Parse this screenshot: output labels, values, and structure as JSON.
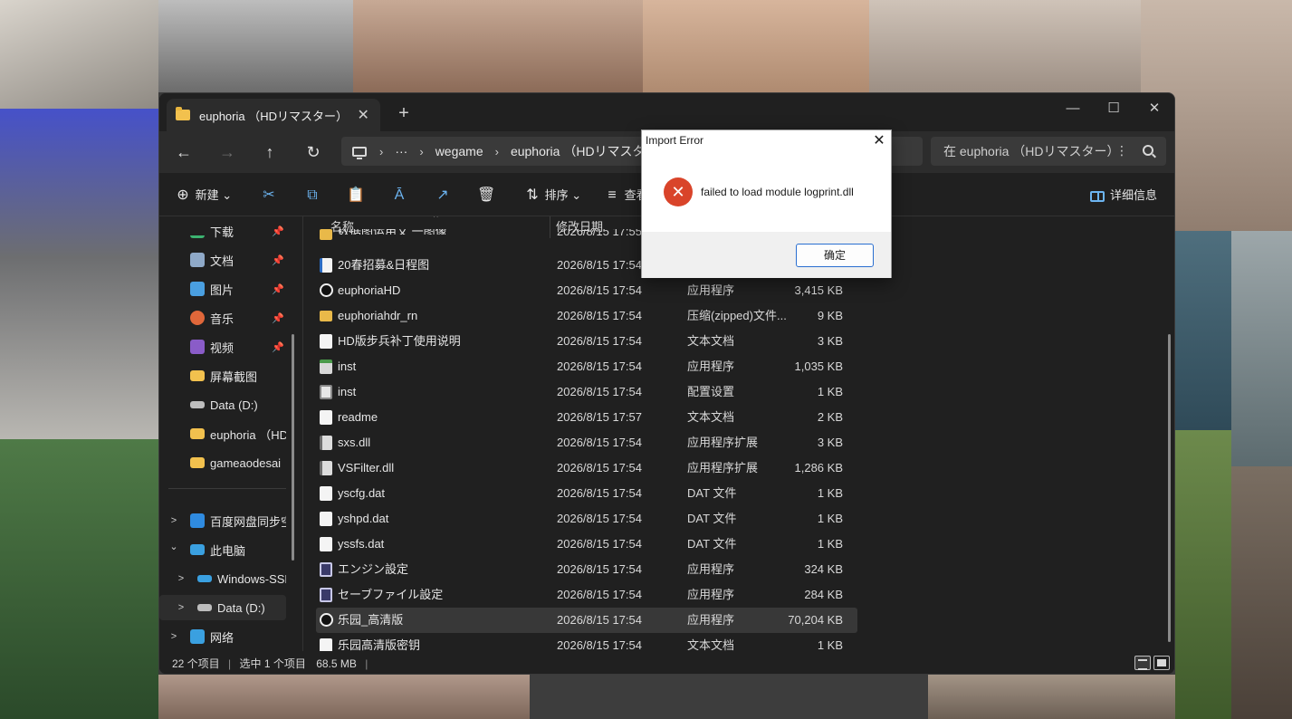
{
  "window": {
    "tab_title": "euphoria （HDリマスター） 魏",
    "tab_close": "✕",
    "new_tab": "+",
    "minimize": "—",
    "maximize": "☐",
    "close": "✕"
  },
  "nav": {
    "back": "←",
    "forward": "→",
    "up": "↑",
    "refresh": "↻"
  },
  "address": {
    "more": "···",
    "crumbs": [
      "wegame",
      "euphoria （HDリマスター）"
    ],
    "sep": "›"
  },
  "search": {
    "placeholder": "在 euphoria （HDリマスター）",
    "more": "⋮"
  },
  "toolbar": {
    "new_label": "新建",
    "new_icon": "⊕",
    "cut_icon": "✂",
    "copy_icon": "⧉",
    "paste_icon": "📋",
    "rename_icon": "Ā",
    "share_icon": "↗",
    "delete_icon": "🗑",
    "sort_label": "排序",
    "sort_icon": "⇅",
    "view_label": "查看",
    "view_icon": "≡",
    "details_label": "详细信息",
    "dropdown": "⌄"
  },
  "sidebar": {
    "items": [
      {
        "label": "下载",
        "icon": "download-icon",
        "color": "#3cb371"
      },
      {
        "label": "文档",
        "icon": "document-icon",
        "color": "#8fa9c8"
      },
      {
        "label": "图片",
        "icon": "picture-icon",
        "color": "#4a9fe0"
      },
      {
        "label": "音乐",
        "icon": "music-icon",
        "color": "#e0673a"
      },
      {
        "label": "视频",
        "icon": "video-icon",
        "color": "#8a5cc8"
      },
      {
        "label": "屏幕截图",
        "icon": "folder-icon",
        "color": "#f2c14e"
      },
      {
        "label": "Data (D:)",
        "icon": "drive-icon",
        "color": "#bdbdbd"
      },
      {
        "label": "euphoria （HD",
        "icon": "folder-icon",
        "color": "#f2c14e"
      },
      {
        "label": "gameaodesai",
        "icon": "folder-icon",
        "color": "#f2c14e"
      },
      {
        "label": "百度网盘同步空",
        "icon": "cloud-icon",
        "color": "#2f8be0"
      },
      {
        "label": "此电脑",
        "icon": "pc-icon",
        "color": "#3aa0e0"
      },
      {
        "label": "Windows-SSD",
        "icon": "drive-icon",
        "color": "#3aa0e0"
      },
      {
        "label": "Data (D:)",
        "icon": "drive-icon",
        "color": "#bdbdbd"
      },
      {
        "label": "网络",
        "icon": "network-icon",
        "color": "#3aa0e0"
      }
    ],
    "pin": "📌",
    "chev_right": ">",
    "chev_down": "⌄"
  },
  "filelist": {
    "headers": {
      "name": "名称",
      "date": "修改日期"
    },
    "sort_indicator": "^",
    "partial_row": {
      "name": "数据图运用文 一图像",
      "date": "2026/8/15 17:55"
    },
    "rows": [
      {
        "name": "20春招募&日程图",
        "date": "2026/8/15 17:54",
        "type": "",
        "size": "",
        "icon": "word-icon"
      },
      {
        "name": "euphoriaHD",
        "date": "2026/8/15 17:54",
        "type": "应用程序",
        "size": "3,415 KB",
        "icon": "app-icon"
      },
      {
        "name": "euphoriahdr_rn",
        "date": "2026/8/15 17:54",
        "type": "压缩(zipped)文件...",
        "size": "9 KB",
        "icon": "zip-icon"
      },
      {
        "name": "HD版步兵补丁使用说明",
        "date": "2026/8/15 17:54",
        "type": "文本文档",
        "size": "3 KB",
        "icon": "document-icon"
      },
      {
        "name": "inst",
        "date": "2026/8/15 17:54",
        "type": "应用程序",
        "size": "1,035 KB",
        "icon": "setup-icon"
      },
      {
        "name": "inst",
        "date": "2026/8/15 17:54",
        "type": "配置设置",
        "size": "1 KB",
        "icon": "config-icon"
      },
      {
        "name": "readme",
        "date": "2026/8/15 17:57",
        "type": "文本文档",
        "size": "2 KB",
        "icon": "document-icon"
      },
      {
        "name": "sxs.dll",
        "date": "2026/8/15 17:54",
        "type": "应用程序扩展",
        "size": "3 KB",
        "icon": "dll-icon"
      },
      {
        "name": "VSFilter.dll",
        "date": "2026/8/15 17:54",
        "type": "应用程序扩展",
        "size": "1,286 KB",
        "icon": "dll-icon"
      },
      {
        "name": "yscfg.dat",
        "date": "2026/8/15 17:54",
        "type": "DAT 文件",
        "size": "1 KB",
        "icon": "document-icon"
      },
      {
        "name": "yshpd.dat",
        "date": "2026/8/15 17:54",
        "type": "DAT 文件",
        "size": "1 KB",
        "icon": "document-icon"
      },
      {
        "name": "yssfs.dat",
        "date": "2026/8/15 17:54",
        "type": "DAT 文件",
        "size": "1 KB",
        "icon": "document-icon"
      },
      {
        "name": "エンジン設定",
        "date": "2026/8/15 17:54",
        "type": "应用程序",
        "size": "324 KB",
        "icon": "pen-icon"
      },
      {
        "name": "セーブファイル設定",
        "date": "2026/8/15 17:54",
        "type": "应用程序",
        "size": "284 KB",
        "icon": "sfs-icon"
      },
      {
        "name": "乐园_高清版",
        "date": "2026/8/15 17:54",
        "type": "应用程序",
        "size": "70,204 KB",
        "icon": "app-icon",
        "selected": true
      },
      {
        "name": "乐园高清版密钥",
        "date": "2026/8/15 17:54",
        "type": "文本文档",
        "size": "1 KB",
        "icon": "document-icon"
      }
    ]
  },
  "status": {
    "count": "22 个项目",
    "selected": "选中 1 个项目",
    "size": "68.5 MB",
    "sep": "|"
  },
  "dialog": {
    "title": "Import Error",
    "close": "✕",
    "error_icon": "✕",
    "message": "failed to load module logprint.dll",
    "ok_label": "确定",
    "error_color": "#d9442a"
  }
}
